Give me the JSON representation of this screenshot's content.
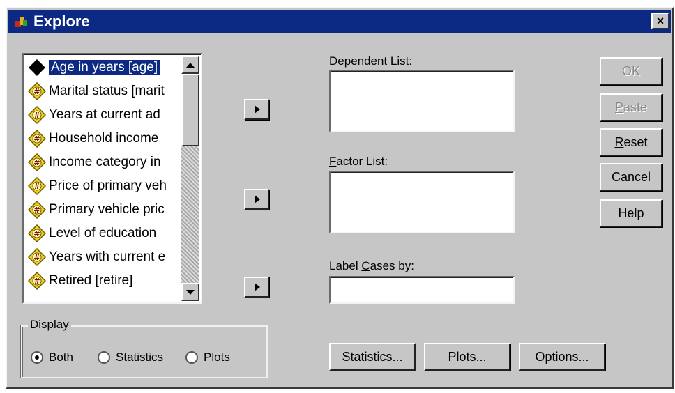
{
  "window": {
    "title": "Explore",
    "close_glyph": "×"
  },
  "variables": [
    {
      "label": "Age in years [age]",
      "icon": "scale-diamond-icon",
      "selected": true
    },
    {
      "label": "Marital status [marit",
      "icon": "ordinal-variable-icon"
    },
    {
      "label": "Years at current ad",
      "icon": "ordinal-variable-icon"
    },
    {
      "label": "Household income",
      "icon": "ordinal-variable-icon"
    },
    {
      "label": "Income category in",
      "icon": "ordinal-variable-icon"
    },
    {
      "label": "Price of primary veh",
      "icon": "ordinal-variable-icon"
    },
    {
      "label": "Primary vehicle pric",
      "icon": "ordinal-variable-icon"
    },
    {
      "label": "Level of education",
      "icon": "ordinal-variable-icon"
    },
    {
      "label": "Years with current e",
      "icon": "ordinal-variable-icon"
    },
    {
      "label": "Retired [retire]",
      "icon": "ordinal-variable-icon"
    }
  ],
  "dependent": {
    "label_pre": "",
    "label_key": "D",
    "label_post": "ependent List:"
  },
  "factor": {
    "label_pre": "",
    "label_key": "F",
    "label_post": "actor List:"
  },
  "labelcases": {
    "label_pre": "Label ",
    "label_key": "C",
    "label_post": "ases by:"
  },
  "buttons": {
    "ok": "OK",
    "paste_key": "P",
    "paste_rest": "aste",
    "reset_key": "R",
    "reset_rest": "eset",
    "cancel": "Cancel",
    "help": "Help",
    "statistics_key": "S",
    "statistics_rest": "tatistics...",
    "plots_pre": "P",
    "plots_key": "l",
    "plots_rest": "ots...",
    "options_key": "O",
    "options_rest": "ptions..."
  },
  "display": {
    "legend": "Display",
    "both_key": "B",
    "both_rest": "oth",
    "statistics_pre": "St",
    "statistics_key": "a",
    "statistics_rest": "tistics",
    "plots_pre": "Plo",
    "plots_key": "t",
    "plots_rest": "s",
    "selected": "both"
  },
  "colors": {
    "titlebar": "#0c2a83",
    "face": "#c6c6c6",
    "selection": "#0c2a83"
  }
}
